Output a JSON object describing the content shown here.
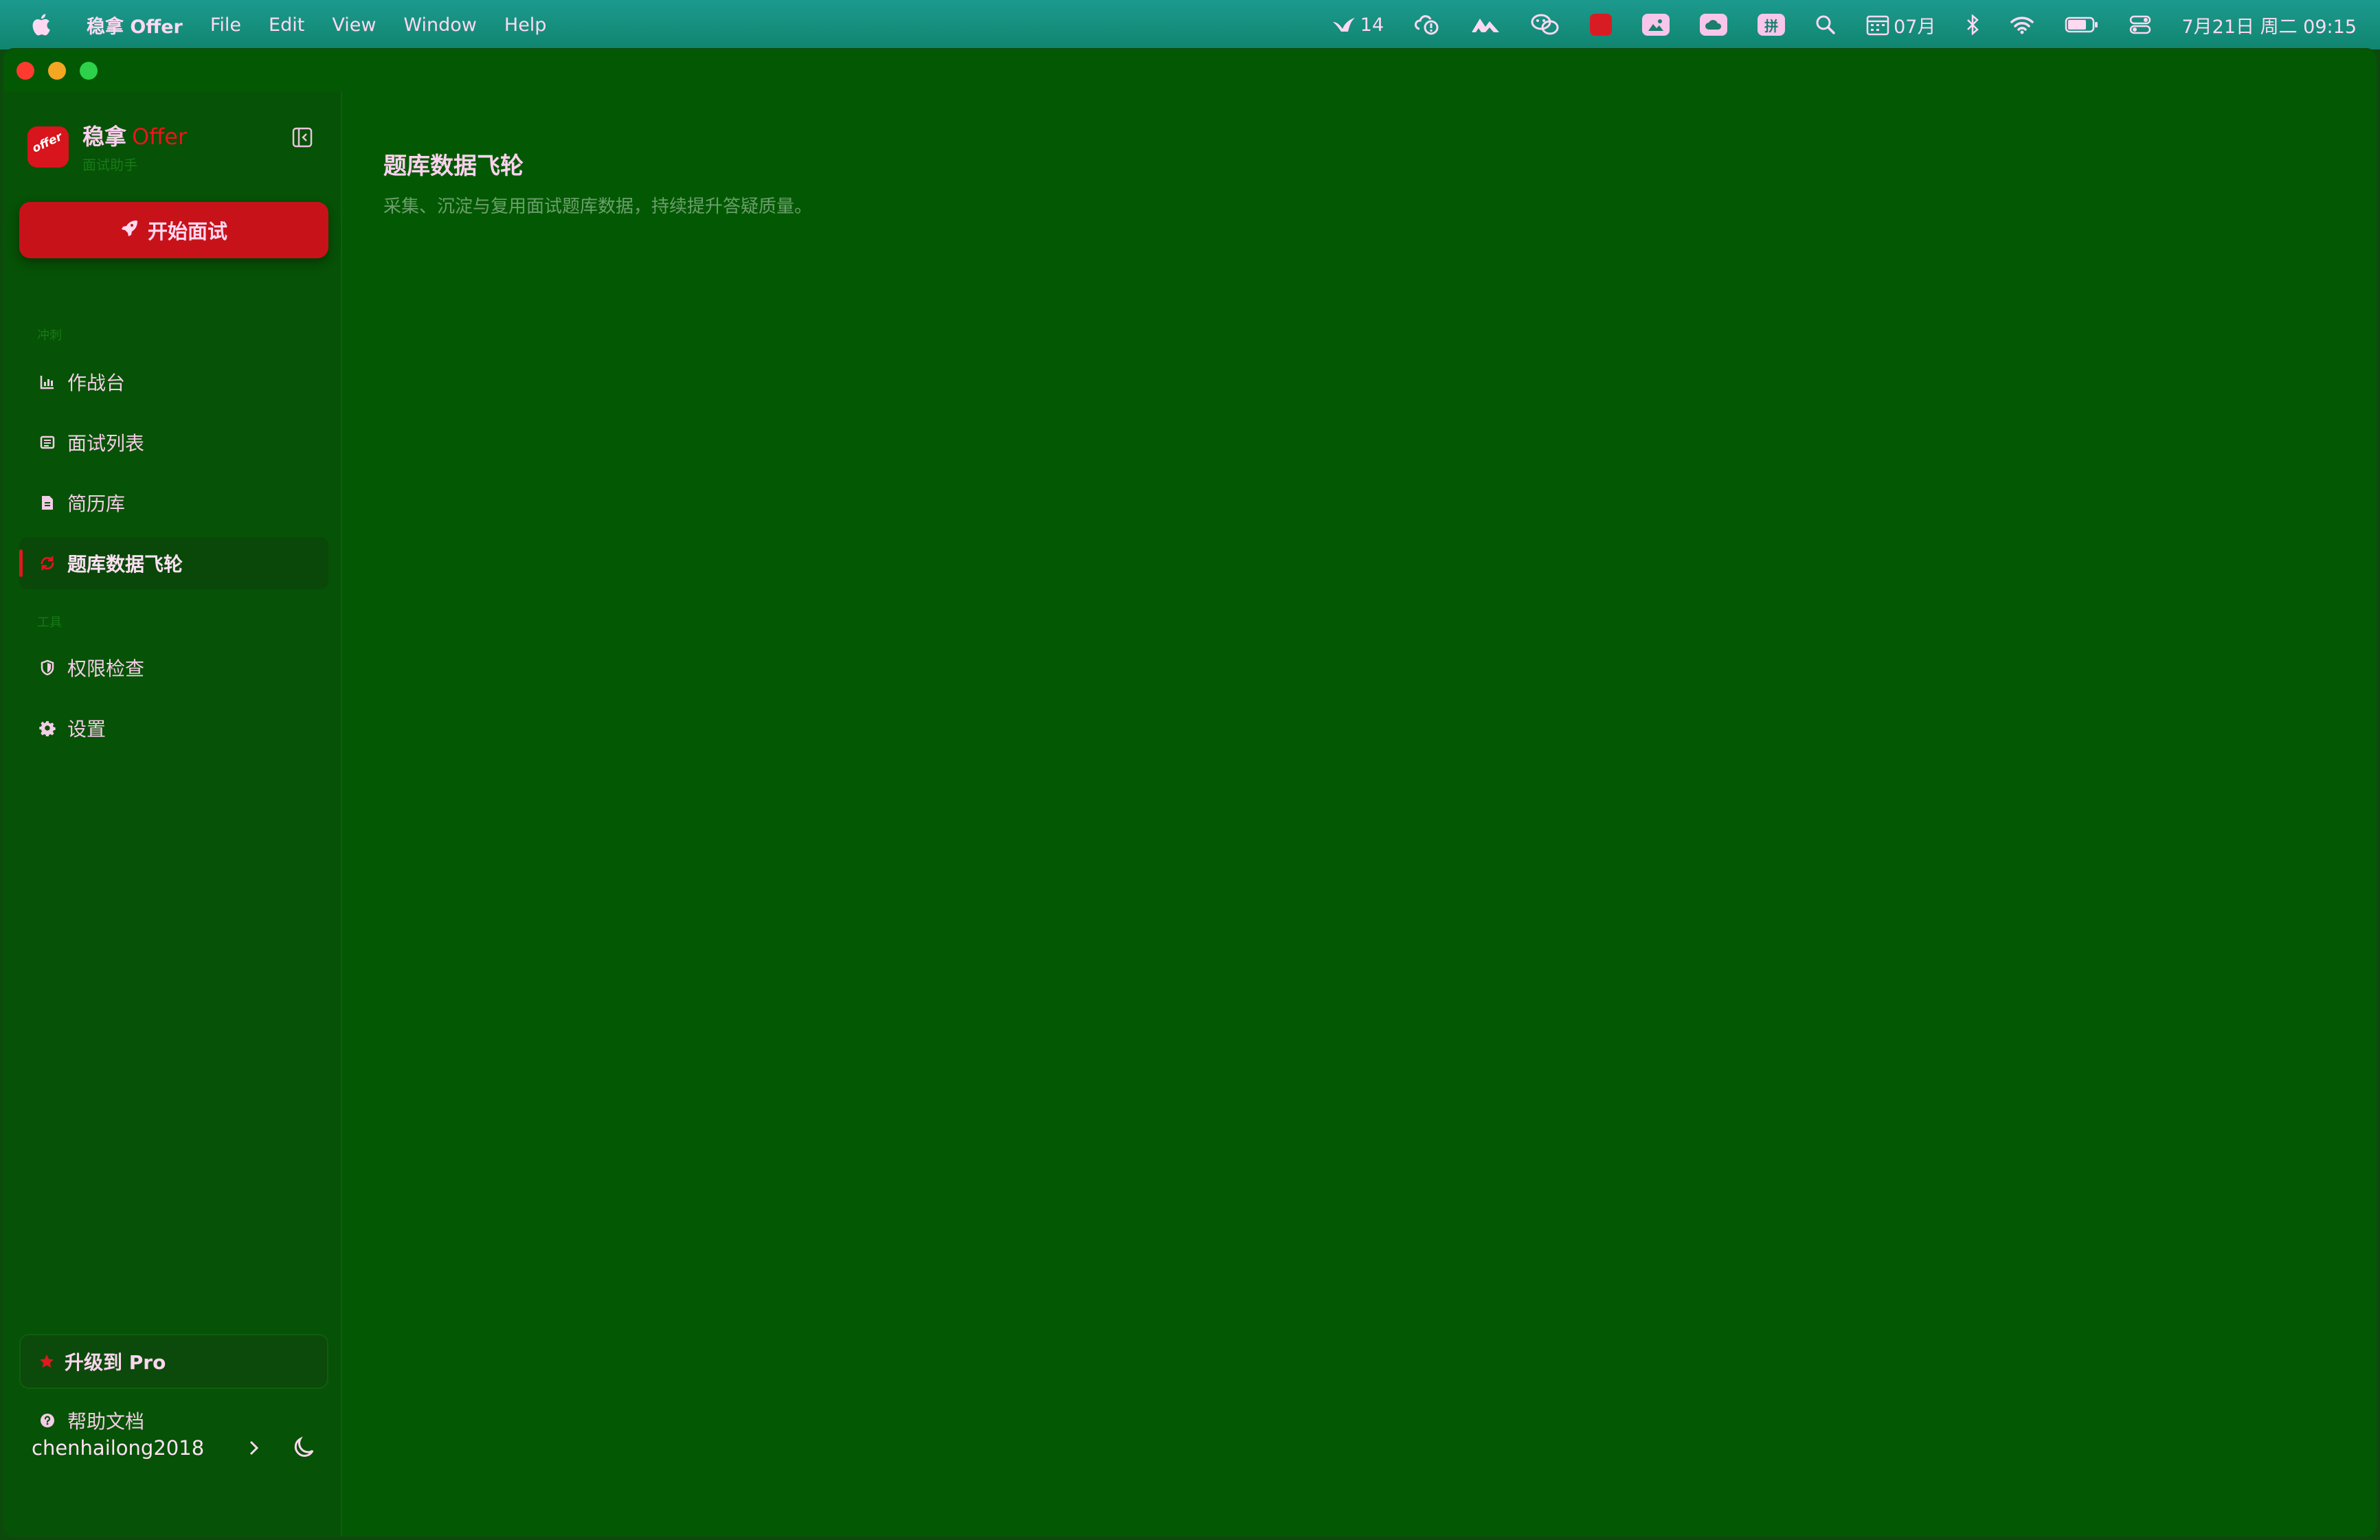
{
  "menubar": {
    "app_name": "稳拿 Offer",
    "menus": [
      "File",
      "Edit",
      "View",
      "Window",
      "Help"
    ],
    "tray": {
      "notification_count": "14",
      "calendar_label": "07月",
      "input_method": "拼",
      "datetime": "7月21日 周二 09:15"
    }
  },
  "sidebar": {
    "brand": {
      "name": "稳拿",
      "accent": "Offer",
      "subtitle": "面试助手",
      "logo_text": "offer"
    },
    "start_button": "开始面试",
    "sections": [
      {
        "label": "冲刺",
        "items": [
          {
            "label": "作战台",
            "icon": "chart-icon"
          },
          {
            "label": "面试列表",
            "icon": "list-icon"
          },
          {
            "label": "简历库",
            "icon": "document-icon"
          },
          {
            "label": "题库数据飞轮",
            "icon": "refresh-icon",
            "active": true
          }
        ]
      },
      {
        "label": "工具",
        "items": [
          {
            "label": "权限检查",
            "icon": "shield-icon"
          },
          {
            "label": "设置",
            "icon": "gear-icon"
          }
        ]
      }
    ],
    "upgrade_button": "升级到 Pro",
    "help_link": "帮助文档",
    "username": "chenhailong2018"
  },
  "main": {
    "title": "题库数据飞轮",
    "description": "采集、沉淀与复用面试题库数据，持续提升答疑质量。"
  },
  "colors": {
    "accent": "#c8121a",
    "window_bg": "#035903",
    "sidebar_bg": "#065206",
    "text": "#ffd2ef"
  }
}
